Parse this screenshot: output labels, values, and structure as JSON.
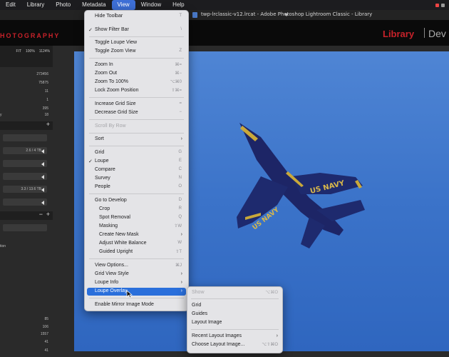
{
  "menubar": {
    "items": [
      "Edit",
      "Library",
      "Photo",
      "Metadata",
      "View",
      "Window",
      "Help"
    ],
    "active_index": 4
  },
  "window": {
    "title": "twp-lrclassic-v12.lrcat - Adobe Photoshop Lightroom Classic - Library"
  },
  "identity_plate": {
    "text": "HOTOGRAPHY",
    "modules": [
      "Library",
      "Dev"
    ]
  },
  "navigator": {
    "zoom": [
      "FIT",
      "100%",
      "1124%"
    ]
  },
  "left_panel": {
    "counts": [
      "273456",
      "75875",
      "11",
      "1",
      "395",
      "18"
    ],
    "sizes": [
      "2.6 / 4 TB",
      "3.3 / 13.6 TB"
    ],
    "side_texts": [
      "y",
      "tion"
    ],
    "bottom_counts": [
      "85",
      "106",
      "1557",
      "41",
      "41"
    ]
  },
  "view_menu": {
    "sections": [
      [
        {
          "label": "Hide Toolbar",
          "shortcut": "T"
        },
        {
          "label": "Show Filter Bar",
          "shortcut": "\\",
          "checked": true
        }
      ],
      [
        {
          "label": "Toggle Loupe View",
          "shortcut": ""
        },
        {
          "label": "Toggle Zoom View",
          "shortcut": "Z"
        }
      ],
      [
        {
          "label": "Zoom In",
          "shortcut": "⌘="
        },
        {
          "label": "Zoom Out",
          "shortcut": "⌘−"
        },
        {
          "label": "Zoom To 100%",
          "shortcut": "⌥⌘0"
        },
        {
          "label": "Lock Zoom Position",
          "shortcut": "⇧⌘="
        }
      ],
      [
        {
          "label": "Increase Grid Size",
          "shortcut": "="
        },
        {
          "label": "Decrease Grid Size",
          "shortcut": "−"
        }
      ],
      [
        {
          "label": "Scroll By Row",
          "shortcut": "",
          "disabled": true
        }
      ],
      [
        {
          "label": "Sort",
          "shortcut": "",
          "submenu": true
        }
      ],
      [
        {
          "label": "Grid",
          "shortcut": "G"
        },
        {
          "label": "Loupe",
          "shortcut": "E",
          "checked": true
        },
        {
          "label": "Compare",
          "shortcut": "C"
        },
        {
          "label": "Survey",
          "shortcut": "N"
        },
        {
          "label": "People",
          "shortcut": "O"
        }
      ],
      [
        {
          "label": "Go to Develop",
          "shortcut": "D"
        },
        {
          "label": "Crop",
          "shortcut": "R",
          "indent": true
        },
        {
          "label": "Spot Removal",
          "shortcut": "Q",
          "indent": true
        },
        {
          "label": "Masking",
          "shortcut": "⇧W",
          "indent": true
        },
        {
          "label": "Create New Mask",
          "shortcut": "",
          "submenu": true,
          "indent": true
        },
        {
          "label": "Adjust White Balance",
          "shortcut": "W",
          "indent": true
        },
        {
          "label": "Guided Upright",
          "shortcut": "⇧T",
          "indent": true
        }
      ],
      [
        {
          "label": "View Options...",
          "shortcut": "⌘J"
        },
        {
          "label": "Grid View Style",
          "shortcut": "",
          "submenu": true
        },
        {
          "label": "Loupe Info",
          "shortcut": "",
          "submenu": true
        },
        {
          "label": "Loupe Overlay",
          "shortcut": "",
          "submenu": true,
          "highlighted": true
        }
      ],
      [
        {
          "label": "Enable Mirror Image Mode",
          "shortcut": ""
        }
      ]
    ]
  },
  "loupe_overlay_menu": {
    "items": [
      {
        "label": "Show",
        "shortcut": "⌥⌘O",
        "disabled": true
      },
      {
        "separator": true
      },
      {
        "label": "Grid",
        "shortcut": ""
      },
      {
        "label": "Guides",
        "shortcut": ""
      },
      {
        "label": "Layout Image",
        "shortcut": ""
      },
      {
        "separator": true
      },
      {
        "label": "Recent Layout Images",
        "shortcut": "",
        "submenu": true
      },
      {
        "label": "Choose Layout Image...",
        "shortcut": "⌥⇧⌘O"
      }
    ]
  },
  "photo": {
    "tail_text_left": "US NAVY",
    "tail_text_right": "US NAVY",
    "sky_color": "#3f77cc",
    "jet_color": "#1d2566"
  },
  "colors": {
    "menu_highlight": "#2a6fdb",
    "brand_red": "#c8222a"
  }
}
